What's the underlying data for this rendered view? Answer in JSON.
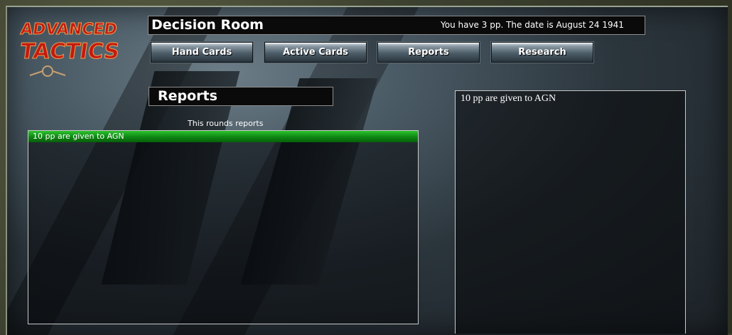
{
  "logo": {
    "line1": "ADVANCED",
    "line2": "TACTICS"
  },
  "header": {
    "title": "Decision Room",
    "status": "You have 3 pp. The date is August 24 1941"
  },
  "nav": {
    "buttons": [
      {
        "label": "Hand Cards"
      },
      {
        "label": "Active Cards"
      },
      {
        "label": "Reports"
      },
      {
        "label": "Research"
      }
    ]
  },
  "section": {
    "title": "Reports"
  },
  "reports": {
    "caption": "This rounds reports",
    "items": [
      {
        "text": "10 pp are given to AGN"
      }
    ],
    "selected_detail": "10 pp are given to AGN"
  },
  "colors": {
    "selected_row": "#0f8a14",
    "bar_background": "#0a0a0a",
    "logo_fill": "#c41a10"
  }
}
